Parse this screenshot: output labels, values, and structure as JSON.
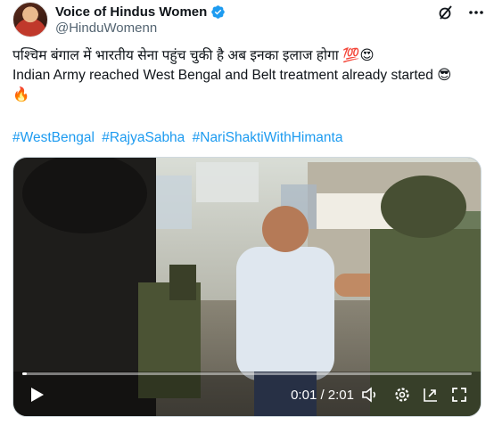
{
  "author": {
    "display_name": "Voice of Hindus Women",
    "handle": "@HinduWomenn"
  },
  "tweet": {
    "line_hindi": "पश्चिम बंगाल में भारतीय सेना पहुंच चुकी है अब इनका इलाज होगा 💯😍",
    "line_english": "Indian Army reached West Bengal and Belt treatment already started 😎",
    "line_emoji": "🔥",
    "hashtags": [
      "#WestBengal",
      "#RajyaSabha",
      "#NariShaktiWithHimanta"
    ]
  },
  "video": {
    "time_display": "0:01 / 2:01",
    "progress": 0.01
  },
  "icons": {
    "verified": "verified-badge-icon",
    "grok": "grok-icon",
    "more": "more-icon",
    "play": "play-icon",
    "volume": "volume-icon",
    "settings": "settings-icon",
    "pip": "pip-icon",
    "fullscreen": "fullscreen-icon"
  },
  "colors": {
    "accent": "#1d9bf0",
    "text": "#0f1419",
    "secondary_text": "#536471"
  }
}
